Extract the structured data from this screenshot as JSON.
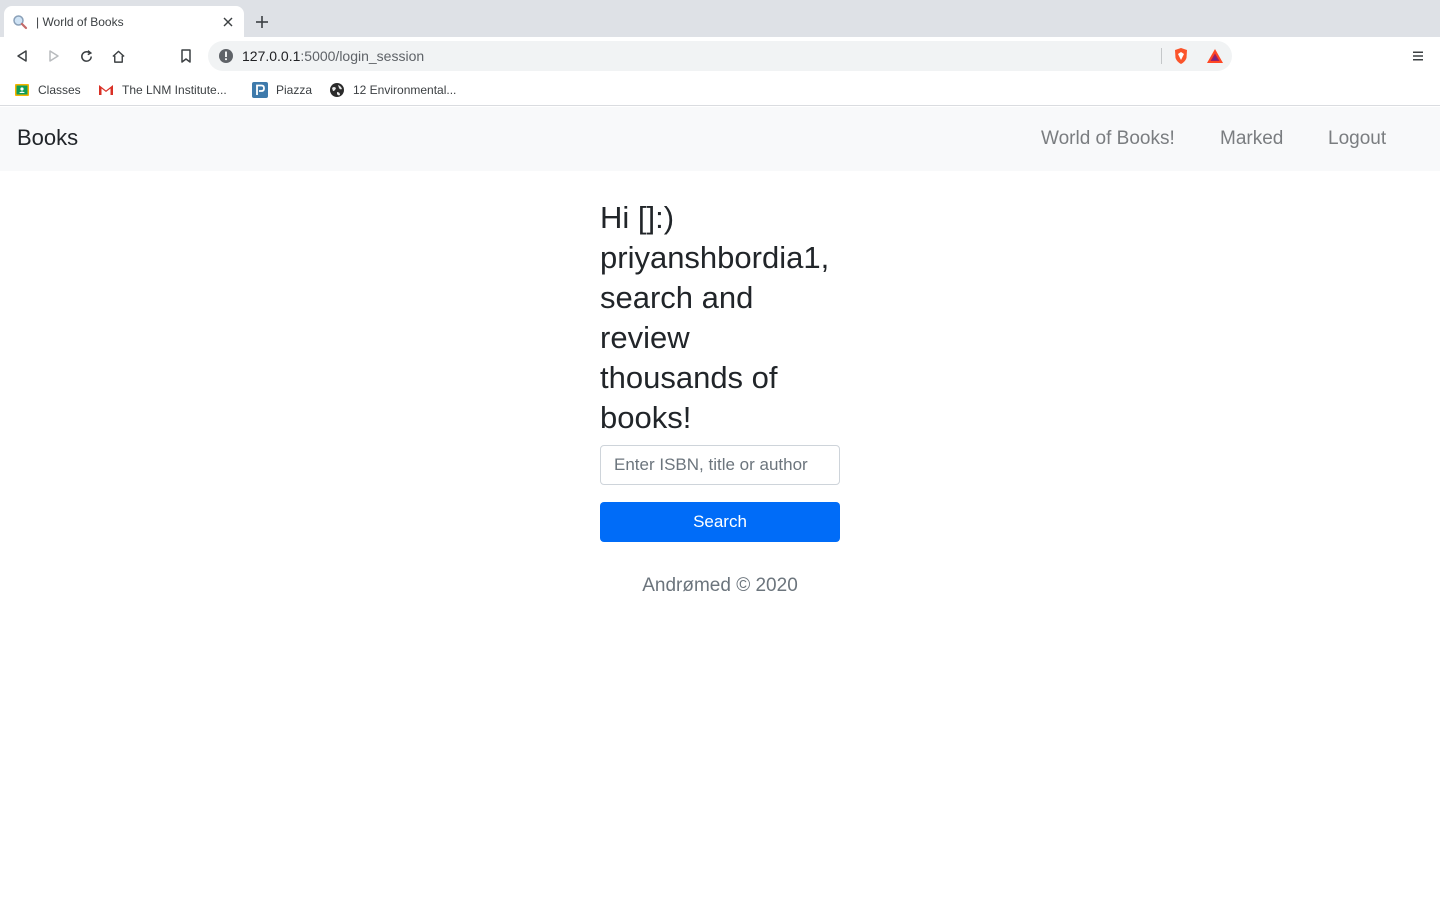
{
  "browser": {
    "tab_title": "| World of Books",
    "url_host": "127.0.0.1",
    "url_rest": ":5000/login_session",
    "bookmarks": [
      {
        "label": "Classes",
        "icon": "google-classroom-icon"
      },
      {
        "label": "The LNM Institute...",
        "icon": "gmail-icon"
      },
      {
        "label": "Piazza",
        "icon": "piazza-icon"
      },
      {
        "label": "12 Environmental...",
        "icon": "globe-icon"
      }
    ]
  },
  "navbar": {
    "brand": "Books",
    "links": [
      "World of Books!",
      "Marked",
      "Logout"
    ]
  },
  "main": {
    "greeting": "Hi []:) priyanshbordia1, search and review thousands of books!",
    "search_placeholder": "Enter ISBN, title or author",
    "search_button": "Search",
    "footer": "Andrømed © 2020"
  },
  "colors": {
    "primary": "#006cf8",
    "navbar_bg": "#f8f9fa",
    "nav_link": "#7a7d80"
  }
}
